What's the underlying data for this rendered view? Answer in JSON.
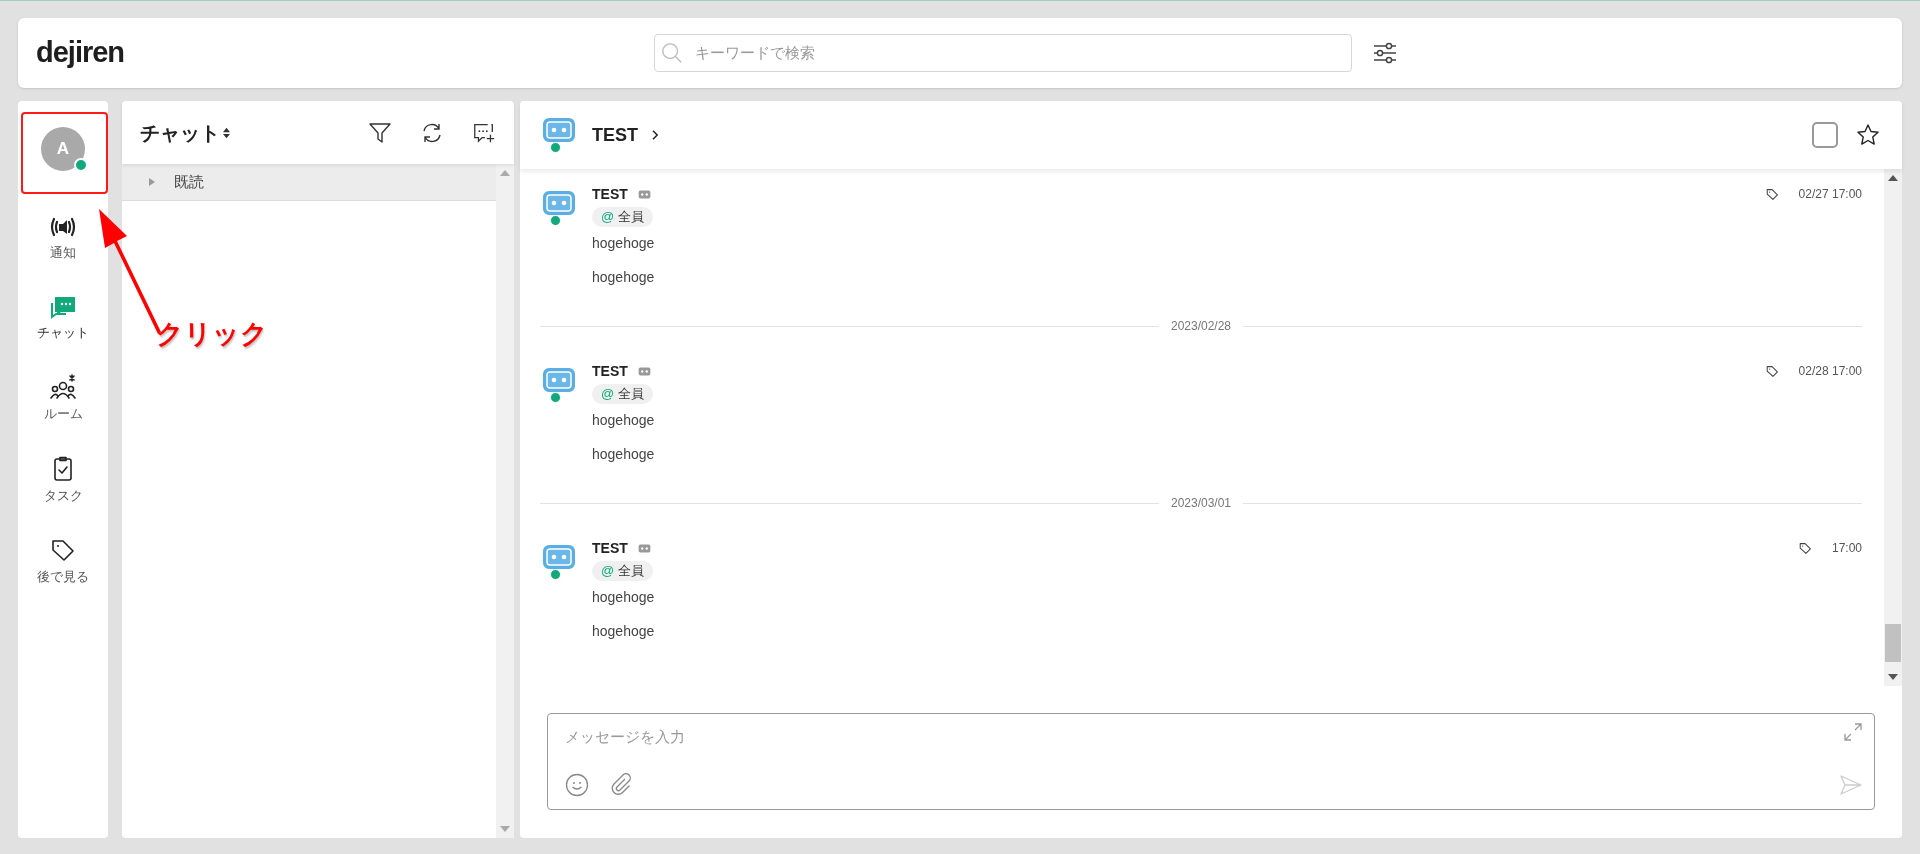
{
  "header": {
    "logo": "dejiren",
    "search": {
      "placeholder": "キーワードで検索"
    }
  },
  "rail": {
    "avatar": {
      "initial": "A",
      "online": true
    },
    "items": [
      {
        "label": "通知",
        "selected": false
      },
      {
        "label": "チャット",
        "selected": true
      },
      {
        "label": "ルーム",
        "selected": false
      },
      {
        "label": "タスク",
        "selected": false
      },
      {
        "label": "後で見る",
        "selected": false
      }
    ]
  },
  "chat_list": {
    "title": "チャット",
    "groups": [
      {
        "label": "既読",
        "expanded": false
      }
    ]
  },
  "conversation": {
    "title": "TEST",
    "online": true,
    "checked": false,
    "timeline": [
      {
        "kind": "message",
        "sender": "TEST",
        "online": true,
        "mention": {
          "mark": "@",
          "label": "全員"
        },
        "time": "02/27 17:00",
        "lines": [
          "hogehoge",
          "hogehoge"
        ]
      },
      {
        "kind": "date",
        "label": "2023/02/28"
      },
      {
        "kind": "message",
        "sender": "TEST",
        "online": true,
        "mention": {
          "mark": "@",
          "label": "全員"
        },
        "time": "02/28 17:00",
        "lines": [
          "hogehoge",
          "hogehoge"
        ]
      },
      {
        "kind": "date",
        "label": "2023/03/01"
      },
      {
        "kind": "message",
        "sender": "TEST",
        "online": true,
        "mention": {
          "mark": "@",
          "label": "全員"
        },
        "time": "17:00",
        "lines": [
          "hogehoge",
          "hogehoge"
        ]
      }
    ]
  },
  "composer": {
    "placeholder": "メッセージを入力"
  },
  "annotation": {
    "label": "クリック"
  }
}
